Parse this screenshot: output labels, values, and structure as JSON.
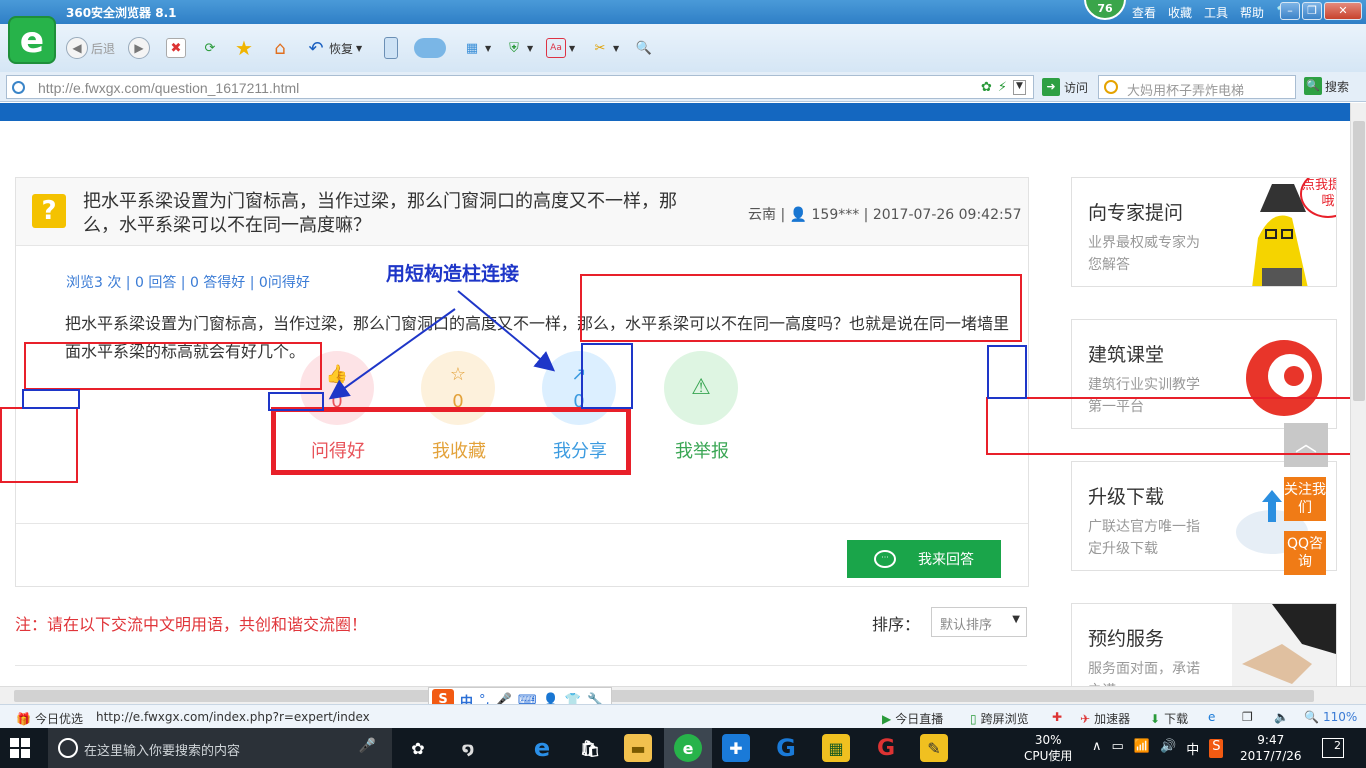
{
  "browser": {
    "app_title": "360安全浏览器 8.1",
    "score": "76",
    "menu": [
      "查看",
      "收藏",
      "工具",
      "帮助"
    ],
    "back_label": "后退",
    "restore_label": "恢复",
    "url": "http://e.fwxgx.com/question_1617211.html",
    "visit_label": "访问",
    "search_placeholder": "大妈用杯子弄炸电梯",
    "search_label": "搜索"
  },
  "question": {
    "title": "把水平系梁设置为门窗标高，当作过梁，那么门窗洞口的高度又不一样，那么，水平系梁可以不在同一高度嘛？",
    "meta": "云南 | 👤 159*** | 2017-07-26 09:42:57",
    "stats": "浏览3 次 | 0 回答 | 0 答得好 | 0问得好",
    "body": "把水平系梁设置为门窗标高，当作过梁，那么门窗洞口的高度又不一样，那么，水平系梁可以不在同一高度吗？也就是说在同一堵墙里面水平系梁的标高就会有好几个。"
  },
  "actions": [
    {
      "label": "问得好",
      "count": "0",
      "color": "#e8535a",
      "bg": "#fde3e6",
      "icon": "👍"
    },
    {
      "label": "我收藏",
      "count": "0",
      "color": "#e3a23a",
      "bg": "#fdf1dc",
      "icon": "☆"
    },
    {
      "label": "我分享",
      "count": "0",
      "color": "#3c9be0",
      "bg": "#dcefff",
      "icon": "↗"
    },
    {
      "label": "我举报",
      "count": "",
      "color": "#3aa654",
      "bg": "#def5e2",
      "icon": "⚠"
    }
  ],
  "answer_button": "我来回答",
  "note": "注：请在以下交流中文明用语，共创和谐交流圈！",
  "sort": {
    "label": "排序：",
    "selected": "默认排序"
  },
  "annotation_text": "用短构造柱连接",
  "sidebar": [
    {
      "title": "向专家提问",
      "sub": "业界最权威专家为您解答",
      "badge": "点我提问哦"
    },
    {
      "title": "建筑课堂",
      "sub": "建筑行业实训教学第一平台"
    },
    {
      "title": "升级下载",
      "sub": "广联达官方唯一指定升级下载"
    },
    {
      "title": "预约服务",
      "sub": "服务面对面，承诺之诺"
    }
  ],
  "float": {
    "follow": "关注我们",
    "qq": "QQ咨询"
  },
  "statusbar": {
    "today": "今日优选",
    "link_url": "http://e.fwxgx.com/index.php?r=expert/index",
    "live": "今日直播",
    "cross_screen": "跨屏浏览",
    "accelerator": "加速器",
    "download": "下载",
    "zoom": "110%"
  },
  "ime": {
    "lang": "中"
  },
  "taskbar": {
    "search_placeholder": "在这里输入你要搜索的内容",
    "cpu_percent": "30%",
    "cpu_label": "CPU使用",
    "ime": "中",
    "time": "9:47",
    "date": "2017/7/26",
    "notifications": "2"
  }
}
